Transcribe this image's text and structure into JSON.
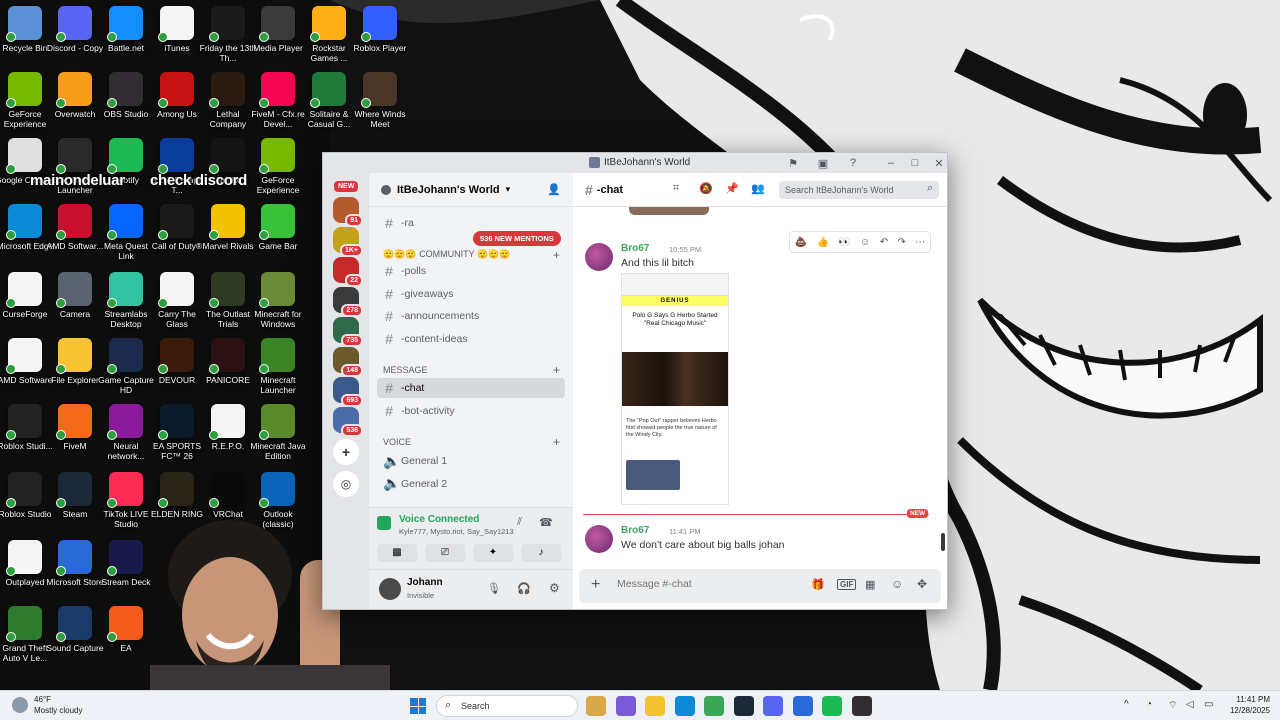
{
  "desktop": {
    "overlay_text_1": "mainondeluar",
    "overlay_text_2": "check discord",
    "icons": [
      {
        "label": "Recycle Bin",
        "color": "#5b8fd6"
      },
      {
        "label": "Discord - Copy",
        "color": "#5865f2"
      },
      {
        "label": "Battle.net",
        "color": "#148eff"
      },
      {
        "label": "iTunes",
        "color": "#f4f4f4"
      },
      {
        "label": "Friday the 13th Th...",
        "color": "#1a1a1a"
      },
      {
        "label": "Media Player",
        "color": "#3a3a3a"
      },
      {
        "label": "Rockstar Games ...",
        "color": "#fcaf17"
      },
      {
        "label": "Roblox Player",
        "color": "#335fff"
      },
      {
        "label": "GeForce Experience",
        "color": "#76b900"
      },
      {
        "label": "Overwatch",
        "color": "#f99e1a"
      },
      {
        "label": "OBS Studio",
        "color": "#302e31"
      },
      {
        "label": "Among Us",
        "color": "#c51111"
      },
      {
        "label": "Lethal Company",
        "color": "#2a1a10"
      },
      {
        "label": "FiveM - Cfx.re Devel...",
        "color": "#f40552"
      },
      {
        "label": "Solitaire & Casual G...",
        "color": "#1f7a3a"
      },
      {
        "label": "Where Winds Meet",
        "color": "#4a3526"
      },
      {
        "label": "Google Chrome",
        "color": "#e0e0e0"
      },
      {
        "label": "Epic Games Launcher",
        "color": "#2a2a2a"
      },
      {
        "label": "Spotify",
        "color": "#1db954"
      },
      {
        "label": "B.E.T Escape T...",
        "color": "#0a3c9c"
      },
      {
        "label": "Netflix",
        "color": "#141414"
      },
      {
        "label": "GeForce Experience",
        "color": "#76b900"
      },
      {
        "label": "Microsoft Edge",
        "color": "#0c8ad6"
      },
      {
        "label": "AMD Softwar...",
        "color": "#c8102e"
      },
      {
        "label": "Meta Quest Link",
        "color": "#0866ff"
      },
      {
        "label": "Call of Duty®",
        "color": "#1a1a1a"
      },
      {
        "label": "Marvel Rivals",
        "color": "#f2c200"
      },
      {
        "label": "Game Bar",
        "color": "#3ac23a"
      },
      {
        "label": "CurseForge",
        "color": "#f4f4f4"
      },
      {
        "label": "Camera",
        "color": "#5a6470"
      },
      {
        "label": "Streamlabs Desktop",
        "color": "#31c3a2"
      },
      {
        "label": "Carry The Glass",
        "color": "#f4f4f4"
      },
      {
        "label": "The Outlast Trials",
        "color": "#2e3a22"
      },
      {
        "label": "Minecraft for Windows",
        "color": "#6a8a3a"
      },
      {
        "label": "AMD Software",
        "color": "#f4f4f4"
      },
      {
        "label": "File Explorer",
        "color": "#f7c331"
      },
      {
        "label": "Game Capture HD",
        "color": "#1b2a4a"
      },
      {
        "label": "DEVOUR",
        "color": "#3a1a0a"
      },
      {
        "label": "PANICORE",
        "color": "#2a1010"
      },
      {
        "label": "Minecraft Launcher",
        "color": "#3c8527"
      },
      {
        "label": "Roblox Studi...",
        "color": "#222222"
      },
      {
        "label": "FiveM",
        "color": "#f46b1b"
      },
      {
        "label": "Neural network...",
        "color": "#8a1a9a"
      },
      {
        "label": "EA SPORTS FC™ 26",
        "color": "#0a1a2a"
      },
      {
        "label": "R.E.P.O.",
        "color": "#f4f4f4"
      },
      {
        "label": "Minecraft Java Edition",
        "color": "#5a8a2a"
      },
      {
        "label": "Roblox Studio",
        "color": "#222222"
      },
      {
        "label": "Steam",
        "color": "#1b2838"
      },
      {
        "label": "TikTok LIVE Studio",
        "color": "#fe2c55"
      },
      {
        "label": "ELDEN RING",
        "color": "#2a2418"
      },
      {
        "label": "VRChat",
        "color": "#0a0a0a"
      },
      {
        "label": "Outlook (classic)",
        "color": "#0a64b8"
      },
      {
        "label": "Outplayed",
        "color": "#f4f4f4"
      },
      {
        "label": "Microsoft Store",
        "color": "#2a6ad6"
      },
      {
        "label": "Stream Deck",
        "color": "#1a1a4a"
      },
      {
        "label": "Grand Theft Auto V Le...",
        "color": "#2e7a2e"
      },
      {
        "label": "Sound Capture",
        "color": "#1a3a6a"
      },
      {
        "label": "EA",
        "color": "#f45a1a"
      }
    ]
  },
  "window": {
    "title": "ItBeJohann's World",
    "controls": {
      "minimize": "–",
      "maximize": "□",
      "close": "✕"
    }
  },
  "servers": {
    "new_label": "NEW",
    "items": [
      {
        "badge": "91",
        "color": "#b35b2e"
      },
      {
        "badge": "1K+",
        "color": "#c4a11a"
      },
      {
        "badge": "22",
        "color": "#c42a2a"
      },
      {
        "badge": "278",
        "color": "#3a3a3a"
      },
      {
        "badge": "735",
        "color": "#2e6a4a"
      },
      {
        "badge": "148",
        "color": "#6a5a2a"
      },
      {
        "badge": "693",
        "color": "#3a5a8a"
      },
      {
        "badge": "536",
        "color": "#4a6aa8"
      }
    ],
    "add_label": "+",
    "discover_label": "◎"
  },
  "guild": {
    "name": "ItBeJohann's World",
    "mentions_pill": "536 NEW MENTIONS",
    "partial_channel": "-ra",
    "community_category": "🫡🫡🫡 COMMUNITY 🫡🫡🫡",
    "community_channels": [
      "-polls",
      "-giveaways",
      "-announcements",
      "-content-ideas"
    ],
    "message_category": "MESSAGE",
    "message_channels": [
      "-chat",
      "-bot-activity"
    ],
    "voice_category": "Voice",
    "voice_channels": [
      "General 1",
      "General 2"
    ]
  },
  "voice_panel": {
    "status": "Voice Connected",
    "members": "Kyle777, Mysto.riot, Say_Say1213"
  },
  "user_panel": {
    "name": "Johann",
    "status": "Invisible"
  },
  "chat": {
    "channel": "-chat",
    "search_placeholder": "Search ItBeJohann's World",
    "messages": [
      {
        "author": "Bro67",
        "time": "10:55 PM",
        "text": "And this lil bitch",
        "attachment": {
          "site": "GENIUS",
          "headline": "Polo G Says G Herbo Started \"Real Chicago Music\"",
          "caption": "The \"Pop Out\" rapper believes Herbo first showed people the true nature of the Windy City."
        }
      },
      {
        "author": "Bro67",
        "time": "11:41 PM",
        "text": "We don't care about big balls johan"
      }
    ],
    "new_divider": "NEW",
    "composer_placeholder": "Message #-chat"
  },
  "taskbar": {
    "weather_temp": "46°F",
    "weather_desc": "Mostly cloudy",
    "search_label": "Search",
    "time": "11:41 PM",
    "date": "12/28/2025"
  }
}
